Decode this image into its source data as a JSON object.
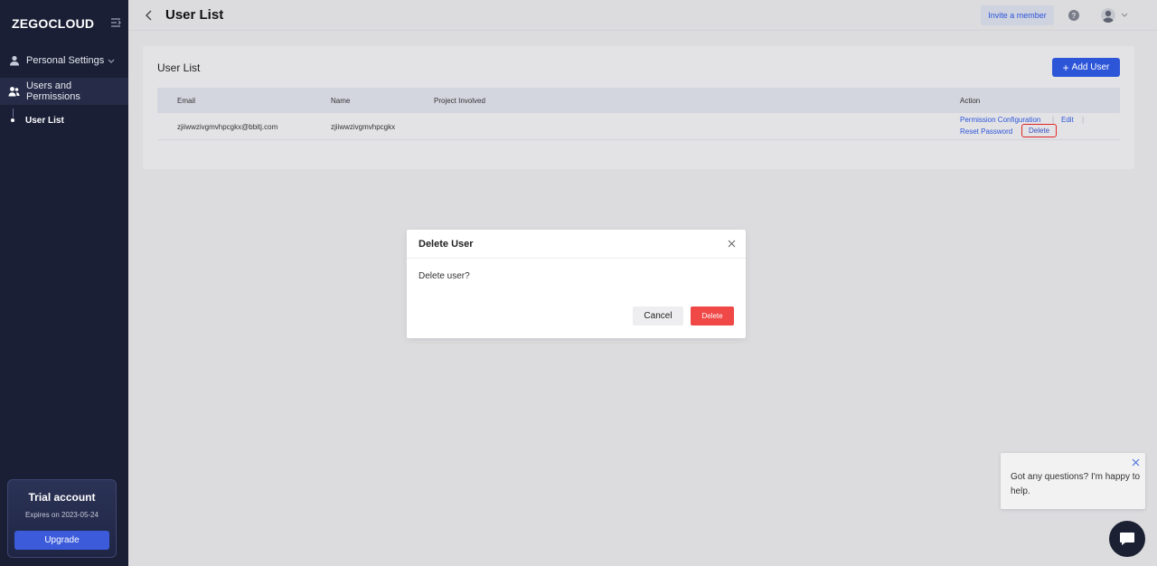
{
  "sidebar": {
    "logo": "ZEGOCLOUD",
    "items": [
      {
        "label": "Personal Settings"
      },
      {
        "label": "Users and Permissions"
      }
    ],
    "sub_items": [
      {
        "label": "User List"
      }
    ],
    "trial": {
      "title": "Trial account",
      "expires": "Expires on 2023-05-24",
      "upgrade_label": "Upgrade"
    }
  },
  "header": {
    "title": "User List",
    "invite_label": "Invite a member",
    "help_label": "?"
  },
  "card": {
    "title": "User List",
    "add_user_label": "Add User",
    "columns": [
      "Email",
      "Name",
      "Project Involved",
      "Action"
    ],
    "rows": [
      {
        "email": "zjiiwwzivgmvhpcgkx@bbitj.com",
        "name": "zjiiwwzivgmvhpcgkx",
        "project": "",
        "actions": {
          "permission": "Permission Configuration",
          "edit": "Edit",
          "reset": "Reset Password",
          "delete": "Delete"
        }
      }
    ]
  },
  "modal": {
    "title": "Delete User",
    "message": "Delete user?",
    "cancel_label": "Cancel",
    "delete_label": "Delete"
  },
  "chat": {
    "message": "Got any questions? I'm happy to help."
  },
  "colors": {
    "sidebar_bg": "#1a1f36",
    "primary": "#2d55d8",
    "danger": "#f04747"
  }
}
